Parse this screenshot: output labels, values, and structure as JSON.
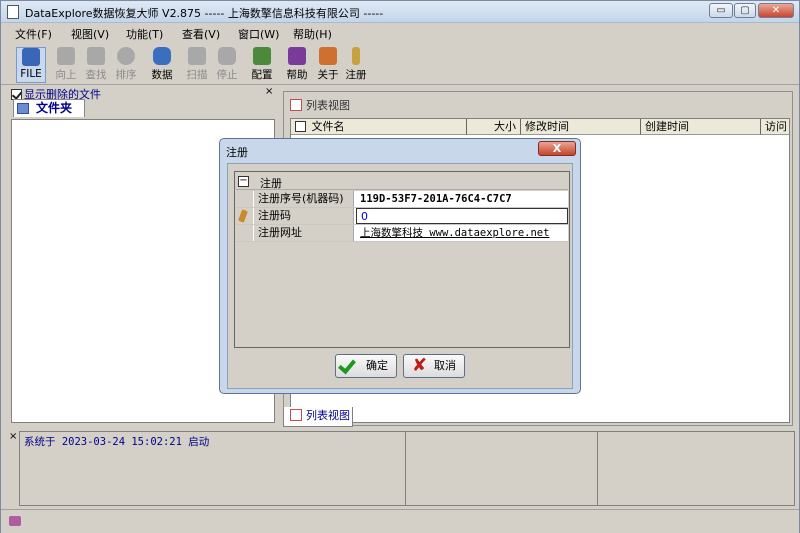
{
  "window": {
    "title": "DataExplore数据恢复大师 V2.875  ----- 上海数擎信息科技有限公司 -----",
    "controls": [
      "▭",
      "▢",
      "✕"
    ]
  },
  "menu": [
    "文件(F)",
    "视图(V)",
    "功能(T)",
    "查看(V)",
    "窗口(W)",
    "帮助(H)"
  ],
  "toolbar": [
    {
      "label": "FILE",
      "icon": "file-icon",
      "state": "selected"
    },
    {
      "label": "向上",
      "icon": "up-icon",
      "state": "disabled"
    },
    {
      "label": "查找",
      "icon": "find-icon",
      "state": "disabled"
    },
    {
      "label": "排序",
      "icon": "sort-icon",
      "state": "disabled"
    },
    {
      "label": "数据",
      "icon": "data-icon",
      "state": "enabled"
    },
    {
      "label": "扫描",
      "icon": "scan-icon",
      "state": "disabled"
    },
    {
      "label": "停止",
      "icon": "stop-icon",
      "state": "disabled"
    },
    {
      "label": "配置",
      "icon": "config-icon",
      "state": "enabled"
    },
    {
      "label": "帮助",
      "icon": "help-icon",
      "state": "enabled"
    },
    {
      "label": "关于",
      "icon": "about-icon",
      "state": "enabled"
    },
    {
      "label": "注册",
      "icon": "register-icon",
      "state": "enabled"
    }
  ],
  "left_panel": {
    "show_deleted_label": "显示删除的文件",
    "show_deleted_checked": true,
    "folder_tab": "文件夹",
    "close": "×"
  },
  "right_panel": {
    "tab_title": "列表视图",
    "columns": [
      "文件名",
      "大小",
      "修改时间",
      "创建时间",
      "访问"
    ],
    "bottom_tab": "列表视图"
  },
  "log": {
    "close": "×",
    "line": "系统于  2023-03-24  15:02:21  启动"
  },
  "dialog": {
    "title": "注册",
    "close": "X",
    "section": "注册",
    "section_toggle": "−",
    "rows": [
      {
        "key": "注册序号(机器码)",
        "value": "119D-53F7-201A-76C4-C7C7"
      },
      {
        "key": "注册码",
        "value": "0"
      },
      {
        "key": "注册网址",
        "value": "上海数擎科技  www.dataexplore.net"
      }
    ],
    "ok_label": "确定",
    "cancel_label": "取消"
  },
  "colors": {
    "accent_text": "#00008b",
    "dialog_frame": "#c8d8ea",
    "close_red": "#c6432b"
  }
}
